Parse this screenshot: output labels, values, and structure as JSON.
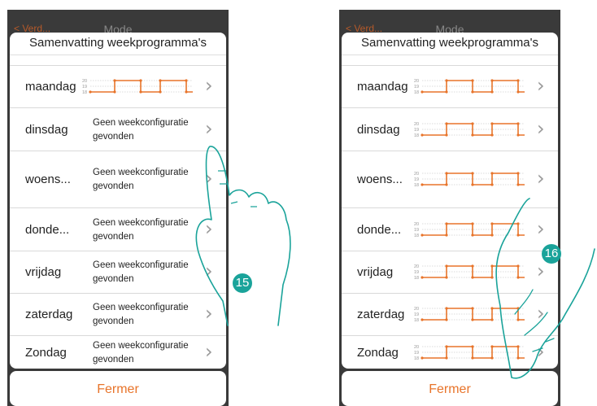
{
  "app": {
    "back_label": "< Verd...",
    "mode_title": "Mode",
    "sheet_title": "Samenvatting weekprogramma's",
    "close_label": "Fermer",
    "no_config_text": "Geen weekconfiguratie gevonden",
    "chevron": "›"
  },
  "chart_scale": [
    "20",
    "19",
    "18"
  ],
  "left": {
    "days": [
      {
        "label": "maandag",
        "configured": true
      },
      {
        "label": "dinsdag",
        "configured": false
      },
      {
        "label": "woens...",
        "configured": false
      },
      {
        "label": "donde...",
        "configured": false
      },
      {
        "label": "vrijdag",
        "configured": false
      },
      {
        "label": "zaterdag",
        "configured": false
      },
      {
        "label": "Zondag",
        "configured": false
      }
    ],
    "step_badge": "15"
  },
  "right": {
    "days": [
      {
        "label": "maandag",
        "configured": true
      },
      {
        "label": "dinsdag",
        "configured": true
      },
      {
        "label": "woens...",
        "configured": true
      },
      {
        "label": "donde...",
        "configured": true
      },
      {
        "label": "vrijdag",
        "configured": true
      },
      {
        "label": "zaterdag",
        "configured": true
      },
      {
        "label": "Zondag",
        "configured": true
      }
    ],
    "step_badge": "16"
  },
  "colors": {
    "accent_orange": "#e8742a",
    "badge_teal": "#1aa39a",
    "background_dark": "#3a3a3a",
    "hand_outline": "#1aa39a"
  },
  "icons": [
    "back-chevron-icon",
    "chevron-right-icon",
    "pointing-hand-icon"
  ]
}
